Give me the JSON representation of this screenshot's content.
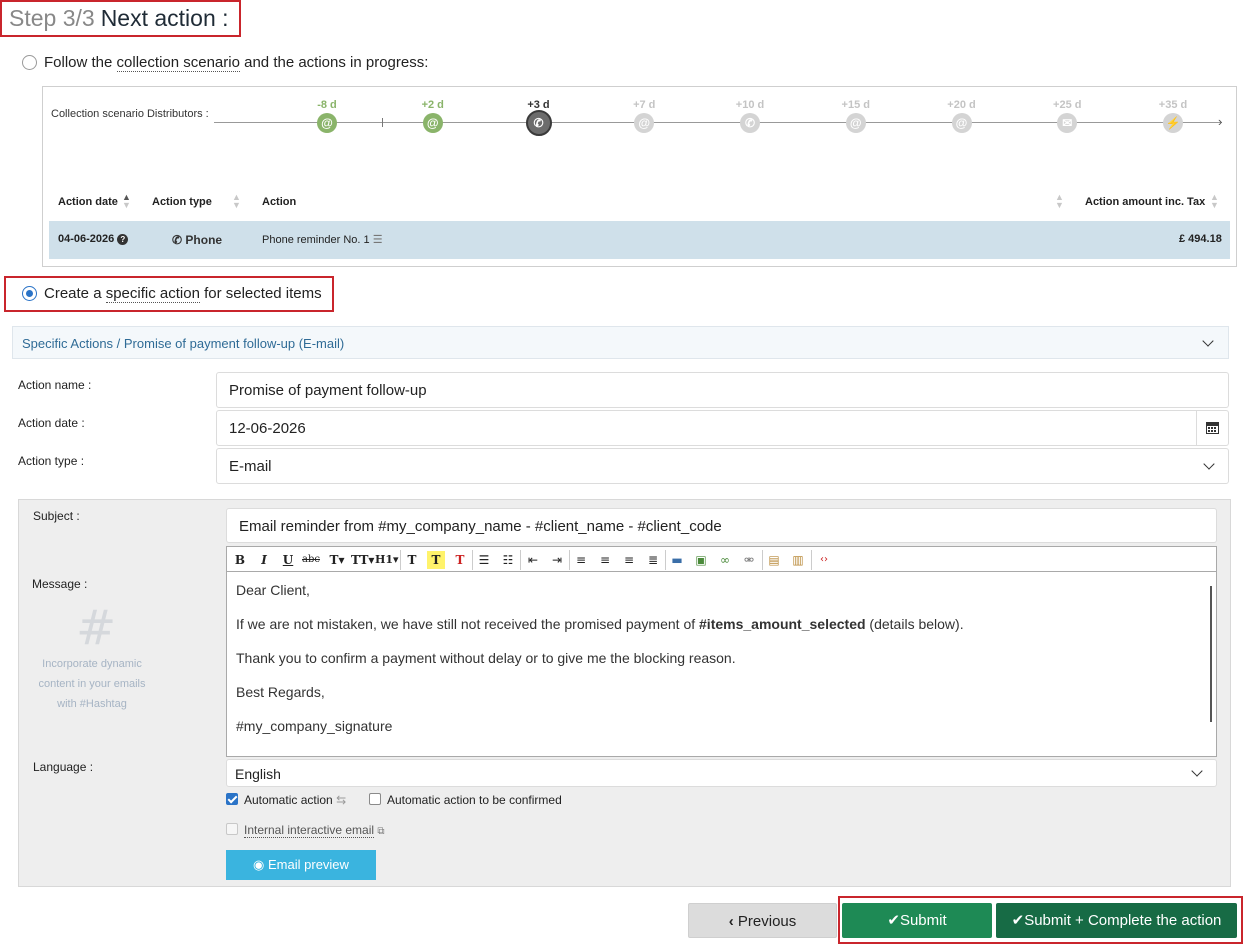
{
  "header": {
    "step": "Step 3/3",
    "title": "Next action :"
  },
  "option_follow": {
    "label_prefix": "Follow the ",
    "label_link": "collection scenario",
    "label_suffix": " and the actions in progress:"
  },
  "scenario": {
    "label": "Collection scenario Distributors :",
    "steps": [
      {
        "day": "-8 d",
        "icon": "at-icon",
        "glyph": "@",
        "state": "done"
      },
      {
        "day": "+2 d",
        "icon": "at-icon",
        "glyph": "@",
        "state": "done"
      },
      {
        "day": "+3 d",
        "icon": "phone-icon",
        "glyph": "✆",
        "state": "current"
      },
      {
        "day": "+7 d",
        "icon": "at-icon",
        "glyph": "@",
        "state": "future"
      },
      {
        "day": "+10 d",
        "icon": "phone-icon",
        "glyph": "✆",
        "state": "future"
      },
      {
        "day": "+15 d",
        "icon": "at-icon",
        "glyph": "@",
        "state": "future"
      },
      {
        "day": "+20 d",
        "icon": "at-icon",
        "glyph": "@",
        "state": "future"
      },
      {
        "day": "+25 d",
        "icon": "envelope-icon",
        "glyph": "✉",
        "state": "future"
      },
      {
        "day": "+35 d",
        "icon": "lightning-icon",
        "glyph": "⚡",
        "state": "future"
      }
    ],
    "colors": {
      "done": "#8ab46a",
      "future": "#d4d4d4",
      "current": "#6c6c6c"
    }
  },
  "table": {
    "headers": {
      "date": "Action date",
      "type": "Action type",
      "action": "Action",
      "amount": "Action amount inc. Tax"
    },
    "row": {
      "date": "04-06-2026",
      "type": "Phone",
      "action": "Phone reminder No. 1",
      "amount": "£ 494.18"
    }
  },
  "option_specific": {
    "label_prefix": "Create a ",
    "label_link": "specific action",
    "label_suffix": " for selected items"
  },
  "accordion": {
    "title": "Specific Actions / Promise of payment follow-up (E-mail)"
  },
  "form": {
    "action_name_label": "Action name :",
    "action_name_value": "Promise of payment follow-up",
    "action_date_label": "Action date :",
    "action_date_value": "12-06-2026",
    "action_type_label": "Action type :",
    "action_type_value": "E-mail"
  },
  "email": {
    "subject_label": "Subject :",
    "subject_value": "Email reminder from #my_company_name - #client_name - #client_code",
    "message_label": "Message :",
    "hashtag_hint": [
      "Incorporate dynamic",
      "content in your emails",
      "with #Hashtag"
    ],
    "message": {
      "line1": "Dear Client,",
      "line2_a": "If we are not mistaken, we have still not received the promised payment of ",
      "line2_b": "#items_amount_selected",
      "line2_c": " (details below).",
      "line3": "Thank you to confirm a payment without delay or to give me the blocking reason.",
      "line4": "Best Regards,",
      "line5": "#my_company_signature"
    },
    "language_label": "Language :",
    "language_value": "English",
    "auto_action_label": "Automatic action",
    "auto_action_checked": true,
    "auto_confirm_label": "Automatic action to be confirmed",
    "auto_confirm_checked": false,
    "internal_email_label": "Internal interactive email",
    "preview_label": "Email preview"
  },
  "buttons": {
    "previous": "Previous",
    "submit": "Submit",
    "submit_complete": "Submit + Complete the action"
  },
  "colors": {
    "highlight": "#c9252c",
    "primary_green": "#1e8a55",
    "dark_green": "#176b45",
    "preview_blue": "#3ab4df",
    "row_bg": "#cfe0ea"
  }
}
